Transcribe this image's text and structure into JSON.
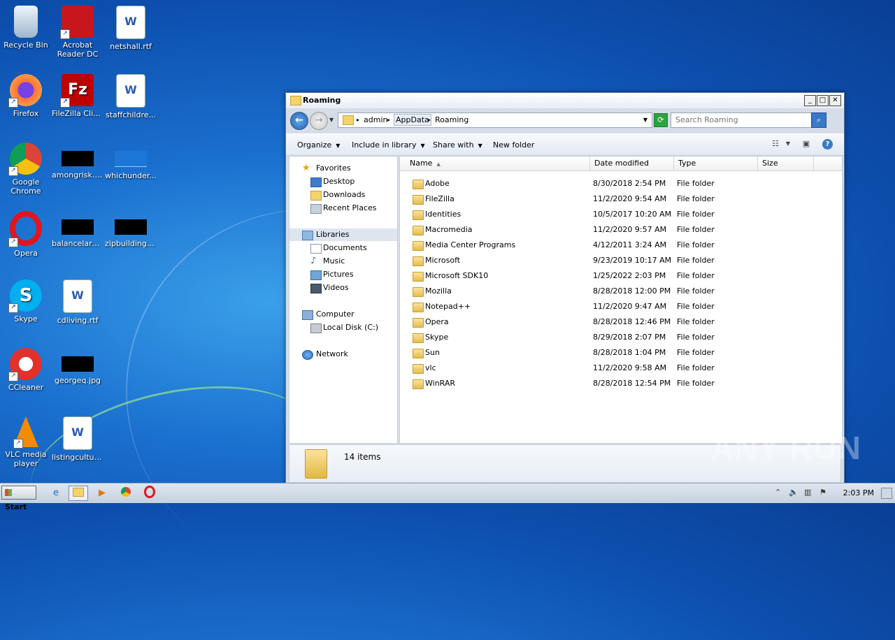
{
  "desktop": {
    "icons": [
      {
        "label": "Recycle Bin"
      },
      {
        "label": "Acrobat Reader DC"
      },
      {
        "label": "netshall.rtf"
      },
      {
        "label": "Firefox"
      },
      {
        "label": "FileZilla Client"
      },
      {
        "label": "staffchildre..."
      },
      {
        "label": "Google Chrome"
      },
      {
        "label": "amongrisk.jpg"
      },
      {
        "label": "whichunder..."
      },
      {
        "label": "Opera"
      },
      {
        "label": "balancelarg..."
      },
      {
        "label": "zipbuilding.jpg"
      },
      {
        "label": "Skype"
      },
      {
        "label": "cdliving.rtf"
      },
      {
        "label": "CCleaner"
      },
      {
        "label": "georgeq.jpg"
      },
      {
        "label": "VLC media player"
      },
      {
        "label": "listingcultur..."
      }
    ]
  },
  "window": {
    "title": "Roaming",
    "breadcrumb": [
      "admin",
      "AppData",
      "Roaming"
    ],
    "search_placeholder": "Search Roaming",
    "commands": {
      "organize": "Organize",
      "include_in_library": "Include in library",
      "share_with": "Share with",
      "new_folder": "New folder"
    },
    "nav": {
      "favorites": "Favorites",
      "desktop": "Desktop",
      "downloads": "Downloads",
      "recent_places": "Recent Places",
      "libraries": "Libraries",
      "documents": "Documents",
      "music": "Music",
      "pictures": "Pictures",
      "videos": "Videos",
      "computer": "Computer",
      "local_disk": "Local Disk (C:)",
      "network": "Network"
    },
    "columns": {
      "name": "Name",
      "date_modified": "Date modified",
      "type": "Type",
      "size": "Size"
    },
    "files": [
      {
        "name": "Adobe",
        "date": "8/30/2018 2:54 PM",
        "type": "File folder"
      },
      {
        "name": "FileZilla",
        "date": "11/2/2020 9:54 AM",
        "type": "File folder"
      },
      {
        "name": "Identities",
        "date": "10/5/2017 10:20 AM",
        "type": "File folder"
      },
      {
        "name": "Macromedia",
        "date": "11/2/2020 9:57 AM",
        "type": "File folder"
      },
      {
        "name": "Media Center Programs",
        "date": "4/12/2011 3:24 AM",
        "type": "File folder"
      },
      {
        "name": "Microsoft",
        "date": "9/23/2019 10:17 AM",
        "type": "File folder"
      },
      {
        "name": "Microsoft SDK10",
        "date": "1/25/2022 2:03 PM",
        "type": "File folder"
      },
      {
        "name": "Mozilla",
        "date": "8/28/2018 12:00 PM",
        "type": "File folder"
      },
      {
        "name": "Notepad++",
        "date": "11/2/2020 9:47 AM",
        "type": "File folder"
      },
      {
        "name": "Opera",
        "date": "8/28/2018 12:46 PM",
        "type": "File folder"
      },
      {
        "name": "Skype",
        "date": "8/29/2018 2:07 PM",
        "type": "File folder"
      },
      {
        "name": "Sun",
        "date": "8/28/2018 1:04 PM",
        "type": "File folder"
      },
      {
        "name": "vlc",
        "date": "11/2/2020 9:58 AM",
        "type": "File folder"
      },
      {
        "name": "WinRAR",
        "date": "8/28/2018 12:54 PM",
        "type": "File folder"
      }
    ],
    "item_count": "14 items"
  },
  "taskbar": {
    "start": "Start",
    "clock": "2:03 PM"
  },
  "watermark": "ANY RUN"
}
